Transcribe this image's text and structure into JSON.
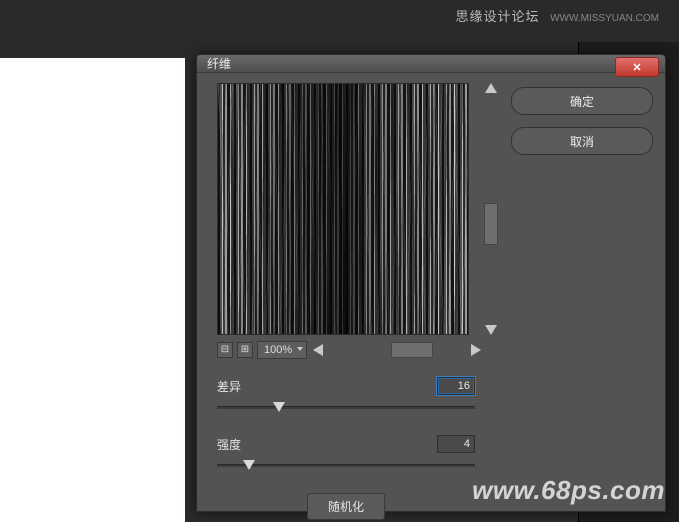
{
  "header": {
    "site_title": "思缘设计论坛",
    "site_url": "WWW.MISSYUAN.COM"
  },
  "dialog": {
    "title": "纤维",
    "close_glyph": "✕",
    "ok_label": "确定",
    "cancel_label": "取消",
    "zoom": {
      "minus_glyph": "⊟",
      "plus_glyph": "⊞",
      "value": "100%"
    },
    "variance": {
      "label": "差异",
      "value": "16"
    },
    "strength": {
      "label": "强度",
      "value": "4"
    },
    "randomize_label": "随机化"
  },
  "watermark": "www.68ps.com"
}
